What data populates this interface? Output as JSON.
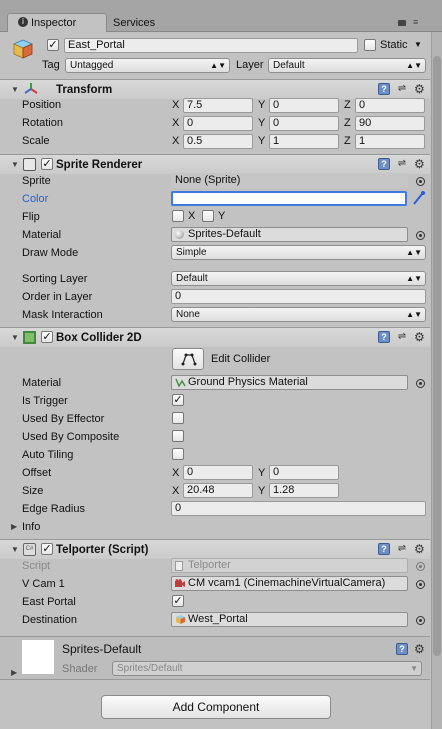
{
  "tabs": {
    "inspector": "Inspector",
    "services": "Services"
  },
  "object": {
    "name": "East_Portal",
    "static_label": "Static",
    "tag_label": "Tag",
    "tag_value": "Untagged",
    "layer_label": "Layer",
    "layer_value": "Default"
  },
  "transform": {
    "title": "Transform",
    "position": {
      "label": "Position",
      "x": "7.5",
      "y": "0",
      "z": "0"
    },
    "rotation": {
      "label": "Rotation",
      "x": "0",
      "y": "0",
      "z": "90"
    },
    "scale": {
      "label": "Scale",
      "x": "0.5",
      "y": "1",
      "z": "1"
    },
    "axis": {
      "x": "X",
      "y": "Y",
      "z": "Z"
    }
  },
  "sprite_renderer": {
    "title": "Sprite Renderer",
    "sprite_label": "Sprite",
    "sprite_value": "None (Sprite)",
    "color_label": "Color",
    "flip_label": "Flip",
    "flip_x": "X",
    "flip_y": "Y",
    "material_label": "Material",
    "material_value": "Sprites-Default",
    "draw_mode_label": "Draw Mode",
    "draw_mode_value": "Simple",
    "sorting_layer_label": "Sorting Layer",
    "sorting_layer_value": "Default",
    "order_label": "Order in Layer",
    "order_value": "0",
    "mask_label": "Mask Interaction",
    "mask_value": "None"
  },
  "box_collider": {
    "title": "Box Collider 2D",
    "edit_collider": "Edit Collider",
    "material_label": "Material",
    "material_value": "Ground Physics Material",
    "is_trigger_label": "Is Trigger",
    "used_by_effector_label": "Used By Effector",
    "used_by_composite_label": "Used By Composite",
    "auto_tiling_label": "Auto Tiling",
    "offset_label": "Offset",
    "offset_x": "0",
    "offset_y": "0",
    "size_label": "Size",
    "size_x": "20.48",
    "size_y": "1.28",
    "edge_radius_label": "Edge Radius",
    "edge_radius_value": "0",
    "info_label": "Info"
  },
  "telporter": {
    "title": "Telporter (Script)",
    "script_label": "Script",
    "script_value": "Telporter",
    "vcam_label": "V Cam 1",
    "vcam_value": "CM vcam1 (CinemachineVirtualCamera)",
    "east_portal_label": "East Portal",
    "destination_label": "Destination",
    "destination_value": "West_Portal"
  },
  "material_preview": {
    "name": "Sprites-Default",
    "shader_label": "Shader",
    "shader_value": "Sprites/Default"
  },
  "add_component": "Add Component",
  "colors": {
    "panel": "#c2c2c2",
    "color_label_blue": "#2a5fd6",
    "field_selected": "#3d7be0"
  }
}
